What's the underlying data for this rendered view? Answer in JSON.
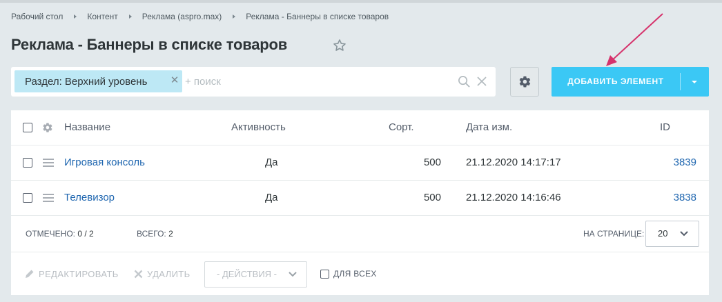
{
  "breadcrumbs": [
    "Рабочий стол",
    "Контент",
    "Реклама (aspro.max)",
    "Реклама - Баннеры в списке товаров"
  ],
  "page_title": "Реклама - Баннеры в списке товаров",
  "filter": {
    "chip_label": "Раздел: Верхний уровень",
    "search_placeholder": "+ поиск"
  },
  "toolbar": {
    "add_label": "ДОБАВИТЬ ЭЛЕМЕНТ"
  },
  "table": {
    "columns": {
      "name": "Название",
      "active": "Активность",
      "sort": "Сорт.",
      "date": "Дата изм.",
      "id": "ID"
    },
    "rows": [
      {
        "name": "Игровая консоль",
        "active": "Да",
        "sort": "500",
        "date": "21.12.2020 14:17:17",
        "id": "3839"
      },
      {
        "name": "Телевизор",
        "active": "Да",
        "sort": "500",
        "date": "21.12.2020 14:16:46",
        "id": "3838"
      }
    ]
  },
  "footer": {
    "selected_label": "ОТМЕЧЕНО:",
    "selected_value": "0 / 2",
    "total_label": "ВСЕГО:",
    "total_value": "2",
    "per_page_label": "НА СТРАНИЦЕ:",
    "per_page_value": "20"
  },
  "actions": {
    "edit_label": "РЕДАКТИРОВАТЬ",
    "delete_label": "УДАЛИТЬ",
    "select_label": "- ДЕЙСТВИЯ -",
    "for_all_label": "ДЛЯ ВСЕХ"
  },
  "icons": [
    "chevron-right-icon",
    "star-icon",
    "close-icon",
    "search-icon",
    "clear-icon",
    "gear-icon",
    "caret-down-icon",
    "drag-handle-icon",
    "pencil-icon",
    "cross-icon",
    "chevron-down-icon",
    "annotation-arrow"
  ],
  "colors": {
    "accent": "#3bc8f5",
    "link": "#2067b0",
    "chip": "#bde8f5",
    "annotation_arrow": "#d6336c",
    "background": "#e3e9ec"
  }
}
